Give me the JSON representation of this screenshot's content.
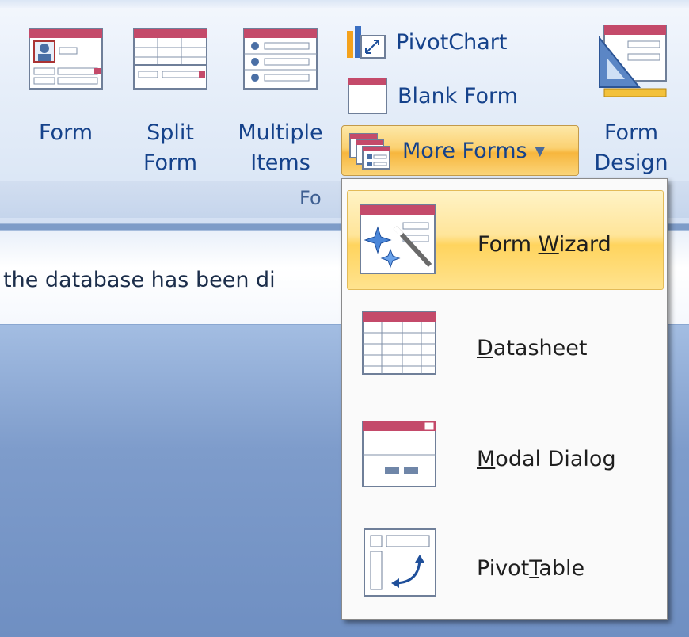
{
  "ribbon": {
    "form": {
      "label": "Form"
    },
    "split_form": {
      "line1": "Split",
      "line2": "Form"
    },
    "multiple_items": {
      "line1": "Multiple",
      "line2": "Items"
    },
    "pivotchart": {
      "label": "PivotChart"
    },
    "blank_form": {
      "label": "Blank Form"
    },
    "more_forms": {
      "label": "More Forms"
    },
    "form_design": {
      "line1": "Form",
      "line2": "Design"
    },
    "group_label": "Fo"
  },
  "info": {
    "text": "the database has been di"
  },
  "menu": {
    "form_wizard": {
      "pre": "Form ",
      "key": "W",
      "post": "izard"
    },
    "datasheet": {
      "pre": "",
      "key": "D",
      "post": "atasheet"
    },
    "modal_dialog": {
      "pre": "",
      "key": "M",
      "post": "odal Dialog"
    },
    "pivottable": {
      "pre": "Pivot",
      "key": "T",
      "post": "able"
    }
  },
  "colors": {
    "accent": "#15428b",
    "highlight": "#ffd45e",
    "ribbon": "#dce7f6"
  }
}
